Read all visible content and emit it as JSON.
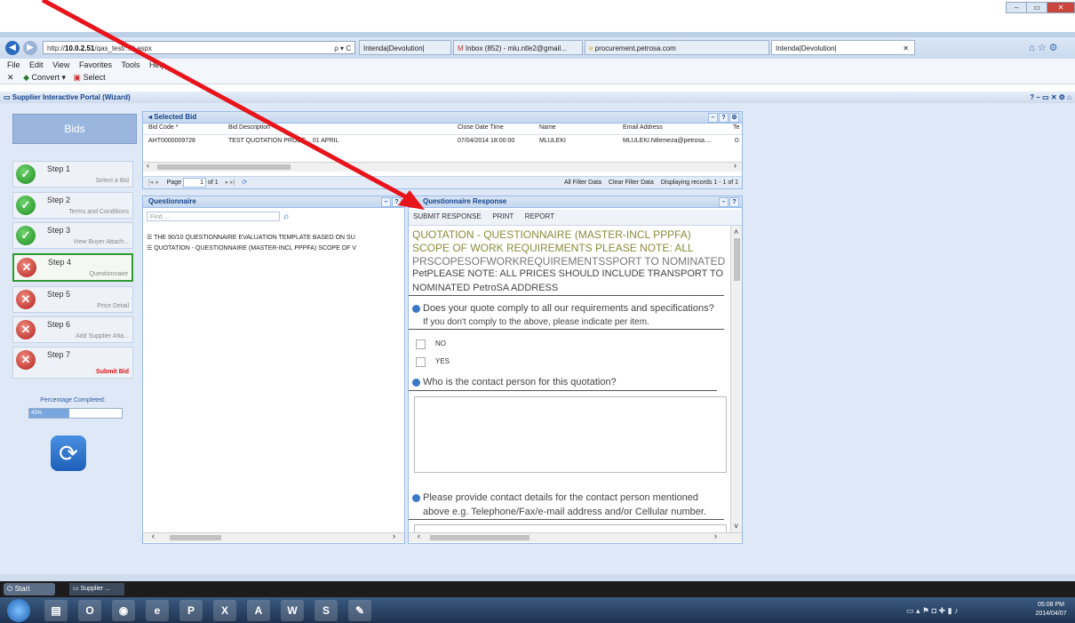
{
  "browser": {
    "url_prefix": "http://",
    "url_host": "10.0.2.51",
    "url_path": "/qas_test/",
    "url_tail": "...lt.aspx",
    "search_glyph": "ρ ▾ C",
    "tabs": [
      {
        "label": "Intenda|Devolution|"
      },
      {
        "label": "Inbox (852) - mlu.ntle2@gmail..."
      },
      {
        "label": "procurement.petrosa.com"
      },
      {
        "label": "Intenda|Devolution|"
      }
    ],
    "tab_close": "✕",
    "menu": [
      "File",
      "Edit",
      "View",
      "Favorites",
      "Tools",
      "Help"
    ],
    "cmd_close": "✕",
    "cmd_convert": "Convert ▾",
    "cmd_select": "Select"
  },
  "portal": {
    "title": "Supplier Interactive Portal (Wizard)",
    "header_tools": "? – ▭ ✕ ⚙ ⌂"
  },
  "wizard": {
    "bids_label": "Bids",
    "steps": [
      {
        "title": "Step 1",
        "sub": "Select a Bid"
      },
      {
        "title": "Step 2",
        "sub": "Terms and Conditions"
      },
      {
        "title": "Step 3",
        "sub": "View Buyer Attach..."
      },
      {
        "title": "Step 4",
        "sub": "Questionnaire"
      },
      {
        "title": "Step 5",
        "sub": "Price Detail"
      },
      {
        "title": "Step 6",
        "sub": "Add Supplier Atta..."
      },
      {
        "title": "Step 7",
        "sub": "Submit Bid"
      }
    ],
    "percentage_label": "Percentage Completed:",
    "percentage_value": "43%",
    "percentage_fraction": 0.43
  },
  "selected_bid": {
    "title": "Selected Bid",
    "columns": [
      "Bid Code *",
      "Bid Description",
      "Close Date Time",
      "Name",
      "Email Address",
      "Te"
    ],
    "row": [
      "AHT0000009728",
      "TEST QUOTATION PROCE... 01 APRIL",
      "07/04/2014 18:00:00",
      "MLULEKI",
      "MLULEKI.Ntlemeza@petrosa....",
      "0:"
    ],
    "pager": {
      "page_label": "Page",
      "page_value": "1",
      "of_label": "of 1",
      "all_filter": "All Filter Data",
      "clear_filter": "Clear Filter Data",
      "displaying": "Displaying records 1 - 1 of 1"
    }
  },
  "questionnaire": {
    "title": "Questionnaire",
    "find_placeholder": "Find ...",
    "items": [
      "THE 90/10 QUESTIONNAIRE EVALUATION TEMPLATE BASED ON SU",
      "QUOTATION - QUESTIONNAIRE (MASTER-INCL PPPFA) SCOPE OF V"
    ]
  },
  "response": {
    "title": "Questionnaire Response",
    "toolbar": [
      "SUBMIT RESPONSE",
      "PRINT",
      "REPORT"
    ],
    "heading_line1": "QUOTATION - QUESTIONNAIRE (MASTER-INCL PPPFA)",
    "heading_line2": "SCOPE OF WORK REQUIREMENTS PLEASE NOTE: ALL",
    "overlap_line": "PRSCOPESOFWORKREQUIREMENTSSPORT TO NOMINATED",
    "overlap_line2": "PetPLEASE NOTE: ALL PRICES SHOULD INCLUDE TRANSPORT TO",
    "note_line": "NOMINATED PetroSA ADDRESS",
    "q1_line1": "Does your quote comply to all our requirements and specifications?",
    "q1_line2": "If you don't comply to the above, please indicate per item.",
    "opt_no": "NO",
    "opt_yes": "YES",
    "q2": "Who is the contact person for this quotation?",
    "q3_line1": "Please provide contact details for the contact person mentioned",
    "q3_line2": "above e.g. Telephone/Fax/e-mail address and/or Cellular number."
  },
  "taskbar": {
    "start_label": "Start",
    "window_label": "Supplier ...",
    "time": "05:08 PM",
    "date": "2014/04/07"
  },
  "colors": {
    "arrow": "#e8141c",
    "header_blue": "#15428b",
    "heading_olive": "#8a8a3a"
  }
}
